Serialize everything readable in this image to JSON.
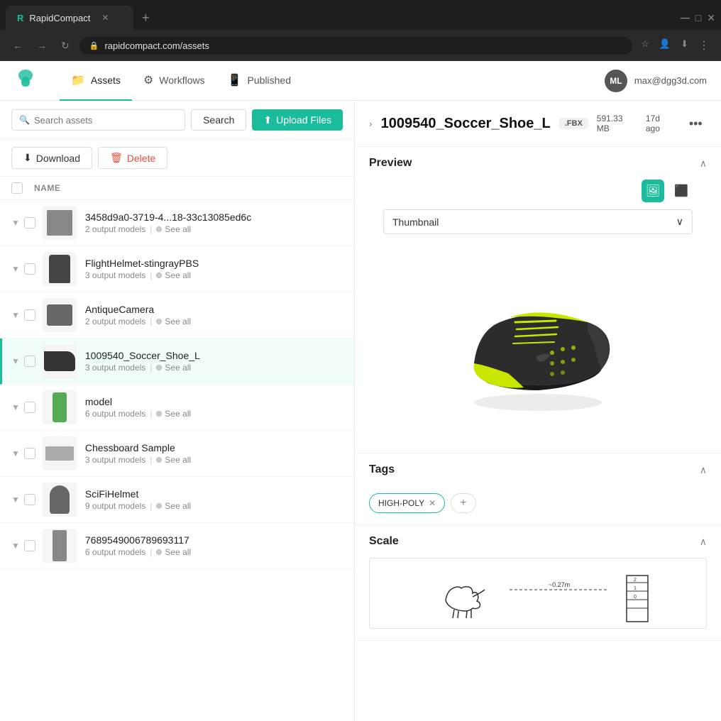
{
  "browser": {
    "tab_title": "RapidCompact",
    "url": "rapidcompact.com/assets",
    "favicon": "R"
  },
  "header": {
    "logo": "R",
    "nav": [
      {
        "id": "assets",
        "label": "Assets",
        "active": true
      },
      {
        "id": "workflows",
        "label": "Workflows",
        "active": false
      },
      {
        "id": "published",
        "label": "Published",
        "active": false
      }
    ],
    "user_initials": "ML",
    "user_email": "max@dgg3d.com"
  },
  "toolbar": {
    "search_placeholder": "Search assets",
    "search_label": "Search",
    "upload_label": "Upload Files",
    "download_label": "Download",
    "delete_label": "Delete"
  },
  "asset_list": {
    "column_name": "NAME",
    "items": [
      {
        "id": "item-1",
        "name": "3458d9a0-3719-4...18-33c13085ed6c",
        "output_count": "2 output models",
        "selected": false
      },
      {
        "id": "item-2",
        "name": "FlightHelmet-stingrayPBS",
        "output_count": "3 output models",
        "selected": false
      },
      {
        "id": "item-3",
        "name": "AntiqueCamera",
        "output_count": "2 output models",
        "selected": false
      },
      {
        "id": "item-4",
        "name": "1009540_Soccer_Shoe_L",
        "output_count": "3 output models",
        "selected": true
      },
      {
        "id": "item-5",
        "name": "model",
        "output_count": "6 output models",
        "selected": false
      },
      {
        "id": "item-6",
        "name": "Chessboard Sample",
        "output_count": "3 output models",
        "selected": false
      },
      {
        "id": "item-7",
        "name": "SciFiHelmet",
        "output_count": "9 output models",
        "selected": false
      },
      {
        "id": "item-8",
        "name": "7689549006789693117",
        "output_count": "6 output models",
        "selected": false
      }
    ]
  },
  "detail_panel": {
    "asset_name": "1009540_Soccer_Shoe_L",
    "file_format": ".FBX",
    "file_size": "591.33 MB",
    "time_ago": "17d ago",
    "more_label": "•••",
    "sections": {
      "preview": {
        "title": "Preview",
        "dropdown_value": "Thumbnail",
        "dropdown_placeholder": "Thumbnail"
      },
      "tags": {
        "title": "Tags",
        "items": [
          {
            "label": "HIGH-POLY"
          }
        ],
        "add_label": "+"
      },
      "scale": {
        "title": "Scale"
      }
    }
  }
}
